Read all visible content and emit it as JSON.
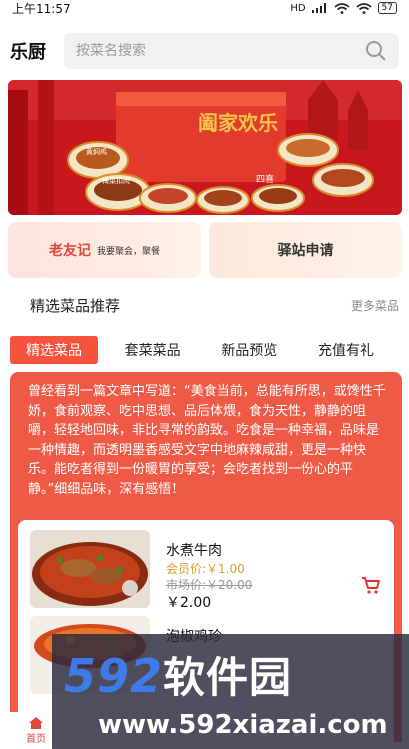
{
  "status_bar": {
    "time": "上午11:57",
    "network": "HD",
    "battery": "57"
  },
  "header": {
    "app_title": "乐厨",
    "search_placeholder": "按菜名搜索"
  },
  "banner": {
    "headline": "阖家欢乐",
    "sub": "四喜",
    "bowl_labels": [
      "黄焖鸡",
      "梅菜扣肉"
    ],
    "colors": {
      "red": "#c3161c",
      "gold": "#f4c44a"
    }
  },
  "promo": {
    "left_title": "老友记",
    "left_sub": "我要聚会，聚餐",
    "right_title": "驿站申请"
  },
  "section": {
    "title": "精选菜品推荐",
    "more": "更多菜品"
  },
  "tabs": [
    "精选菜品",
    "套菜菜品",
    "新品预览",
    "充值有礼"
  ],
  "feature": {
    "quote": "曾经看到一篇文章中写道：“美食当前，总能有所思，或馋性千娇，食前观察、吃中思想、品后体煨，食为天性，静静的咀嚼，轻轻地回味，非比寻常的韵致。吃食是一种幸福，品味是一种情趣，而透明墨香感受文字中地麻辣咸甜，更是一种快乐。能吃者得到一份暖胃的享受；会吃者找到一份心的平静。”细细品味，深有感悟！"
  },
  "dishes": [
    {
      "name": "水煮牛肉",
      "member_price": "会员价:￥1.00",
      "market_price": "市场价:￥20.00",
      "price": "￥2.00"
    },
    {
      "name": "泡椒鸡珍",
      "member_price": "",
      "market_price": "",
      "price": ""
    }
  ],
  "watermark": {
    "logo_num": "592",
    "logo_text": "软件园",
    "url": "www.592xiazai.com"
  },
  "bottom_nav": {
    "home": "首页"
  },
  "colors": {
    "accent": "#f5533d",
    "panel": "#ef5a47",
    "member_gold": "#d3a330"
  }
}
